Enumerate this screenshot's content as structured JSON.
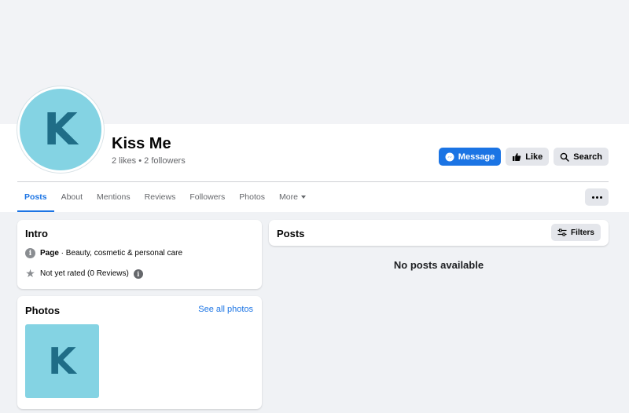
{
  "profile": {
    "initial": "K",
    "name": "Kiss Me",
    "stats": "2 likes • 2 followers"
  },
  "actions": {
    "message": "Message",
    "like": "Like",
    "search": "Search"
  },
  "tabs": [
    {
      "label": "Posts",
      "active": true
    },
    {
      "label": "About"
    },
    {
      "label": "Mentions"
    },
    {
      "label": "Reviews"
    },
    {
      "label": "Followers"
    },
    {
      "label": "Photos"
    },
    {
      "label": "More"
    }
  ],
  "intro": {
    "title": "Intro",
    "category_prefix": "Page",
    "category": " · Beauty, cosmetic & personal care",
    "rating": "Not yet rated (0 Reviews)"
  },
  "photos": {
    "title": "Photos",
    "see_all": "See all photos",
    "thumb_initial": "K"
  },
  "posts": {
    "title": "Posts",
    "filters": "Filters",
    "empty": "No posts available"
  },
  "colors": {
    "accent": "#1b74e4",
    "avatar_bg": "#84d3e3",
    "avatar_letter": "#1f6d87"
  }
}
